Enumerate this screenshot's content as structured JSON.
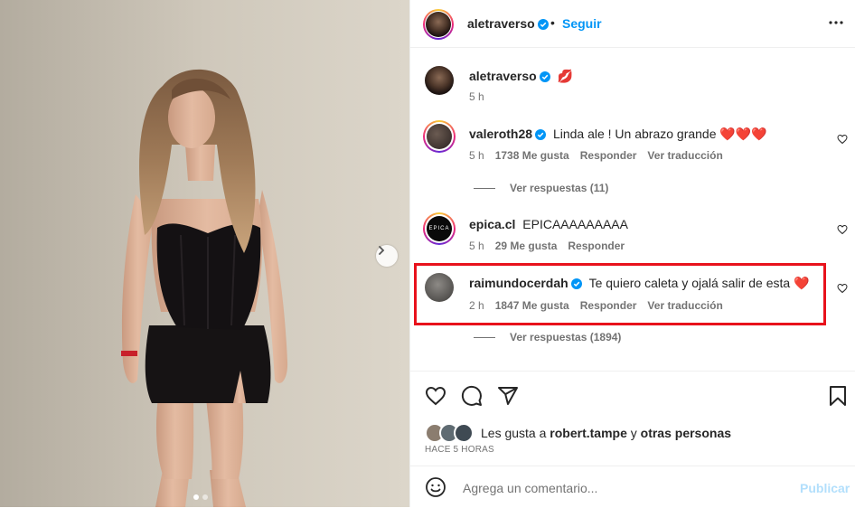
{
  "post": {
    "author": "aletraverso",
    "follow_label": "Seguir",
    "bullet": "•",
    "caption": {
      "username": "aletraverso",
      "emoji": "💋",
      "time": "5 h"
    }
  },
  "comments": [
    {
      "username": "valeroth28",
      "text": "Linda ale ! Un abrazo grande ❤️❤️❤️",
      "time": "5 h",
      "likes": "1738 Me gusta",
      "reply": "Responder",
      "translate": "Ver traducción",
      "replies_label": "Ver respuestas (11)"
    },
    {
      "username": "epica.cl",
      "text": "EPICAAAAAAAAA",
      "time": "5 h",
      "likes": "29 Me gusta",
      "reply": "Responder",
      "avatar_text": "EPICA"
    },
    {
      "username": "raimundocerdah",
      "text": "Te quiero caleta y ojalá salir de esta ❤️",
      "time": "2 h",
      "likes": "1847 Me gusta",
      "reply": "Responder",
      "translate": "Ver traducción",
      "replies_label": "Ver respuestas (1894)"
    }
  ],
  "likes_summary": {
    "prefix": "Les gusta a ",
    "user": "robert.tampe",
    "middle": " y ",
    "others": "otras personas"
  },
  "timestamp": "HACE 5 HORAS",
  "add_comment": {
    "placeholder": "Agrega un comentario...",
    "publish": "Publicar"
  },
  "colors": {
    "link_blue": "#0095f6",
    "highlight_red": "#e8121c",
    "heart_red": "#ed4956",
    "verified_blue": "#0095f6"
  },
  "icons": {
    "verified": "verified-badge-icon",
    "more": "more-horizontal-icon",
    "like": "heart-icon",
    "comment": "speech-bubble-icon",
    "share": "paper-plane-icon",
    "save": "bookmark-icon",
    "emoji": "smiley-icon",
    "next": "chevron-right-icon"
  },
  "carousel": {
    "slides": 2,
    "current": 1
  }
}
